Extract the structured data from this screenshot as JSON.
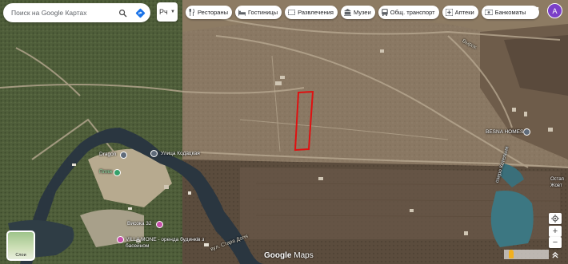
{
  "search": {
    "placeholder": "Поиск на Google Картах"
  },
  "language": {
    "label": "Рч"
  },
  "categories": [
    {
      "label": "Рестораны",
      "icon": "fork-knife-icon"
    },
    {
      "label": "Гостиницы",
      "icon": "bed-icon"
    },
    {
      "label": "Развлечения",
      "icon": "ticket-icon"
    },
    {
      "label": "Музеи",
      "icon": "museum-icon"
    },
    {
      "label": "Общ. транспорт",
      "icon": "bus-icon"
    },
    {
      "label": "Аптеки",
      "icon": "pharmacy-icon"
    },
    {
      "label": "Банкоматы",
      "icon": "cash-icon"
    }
  ],
  "account": {
    "initial": "А"
  },
  "places": [
    {
      "label": "Dragon",
      "icon": "camera-icon"
    },
    {
      "label": "Улица Кодацкая",
      "icon": "camera-icon"
    },
    {
      "label": "Пляж",
      "icon": "beach-icon"
    },
    {
      "label": "BESNA HOMES",
      "icon": "pin-icon"
    },
    {
      "label": "Висока 32",
      "icon": "hotel-icon"
    },
    {
      "label": "VILLA MONE - оренда будинків з басейном",
      "icon": "hotel-icon"
    }
  ],
  "roads": {
    "vyrok": "Вырок",
    "kotelnya": "озеро Котельня",
    "stara_dolia": "вул. Стара Доля",
    "ostan": "Остап",
    "zhovt": "Жовт"
  },
  "layers": {
    "label": "Слои"
  },
  "brand": {
    "google": "Google",
    "maps": "Maps"
  },
  "zoom": {
    "in": "+",
    "out": "−"
  },
  "colors": {
    "highlight_outline": "#e01010",
    "avatar": "#7b3fc8",
    "chip_icon": "#5f6368"
  }
}
